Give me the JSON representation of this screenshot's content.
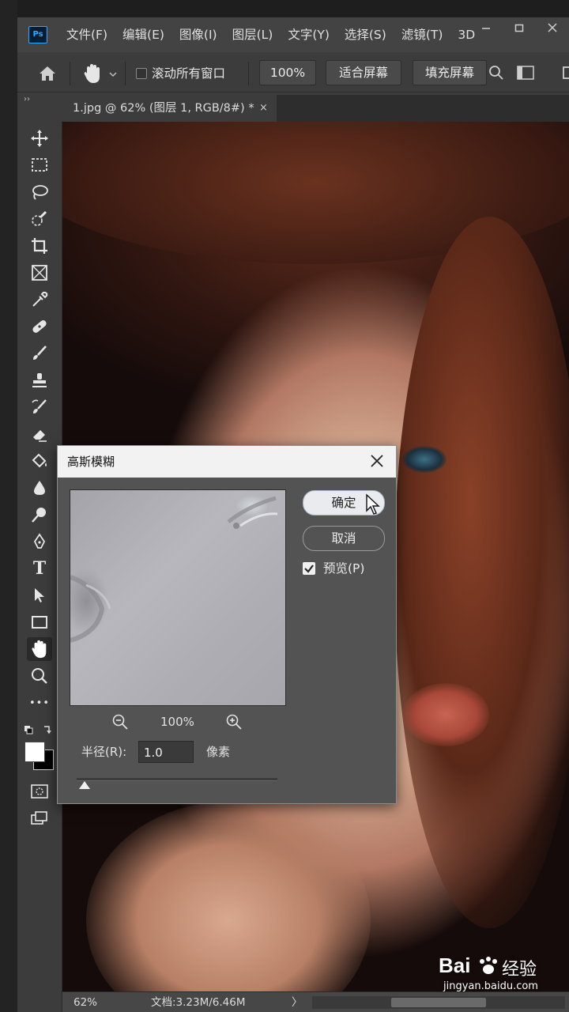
{
  "app": {
    "logo": "Ps",
    "menu": [
      "文件(F)",
      "编辑(E)",
      "图像(I)",
      "图层(L)",
      "文字(Y)",
      "选择(S)",
      "滤镜(T)",
      "3D"
    ],
    "window_controls": [
      "minimize-icon",
      "restore-icon",
      "close-icon"
    ]
  },
  "options": {
    "scroll_all_windows": "滚动所有窗口",
    "zoom_value": "100%",
    "fit_screen": "适合屏幕",
    "fill_screen": "填充屏幕"
  },
  "document": {
    "tab_title": "1.jpg @ 62% (图层 1, RGB/8#) *",
    "close_glyph": "×"
  },
  "toolbar": {
    "collapse_glyph": "››",
    "tools": [
      "move-tool",
      "marquee-tool",
      "lasso-tool",
      "quick-select-tool",
      "crop-tool",
      "frame-tool",
      "eyedropper-tool",
      "healing-tool",
      "brush-tool",
      "stamp-tool",
      "history-brush-tool",
      "eraser-tool",
      "paint-bucket-tool",
      "blur-tool",
      "dodge-tool",
      "pen-tool",
      "type-tool",
      "path-select-tool",
      "rectangle-tool",
      "hand-tool",
      "zoom-tool",
      "more-tools"
    ],
    "type_glyph": "T",
    "more_glyph": "•••"
  },
  "status": {
    "zoom": "62%",
    "doc_size": "文档:3.23M/6.46M",
    "arrow": "〉"
  },
  "dialog": {
    "title": "高斯模糊",
    "ok_label": "确定",
    "cancel_label": "取消",
    "preview_label": "预览(P)",
    "preview_checked": true,
    "zoom_level": "100%",
    "radius_label": "半径(R):",
    "radius_value": "1.0",
    "radius_unit": "像素",
    "slider_fraction": 0.04
  },
  "watermark": {
    "brand": "Bai",
    "brand_cn": "经验",
    "url": "jingyan.baidu.com"
  }
}
